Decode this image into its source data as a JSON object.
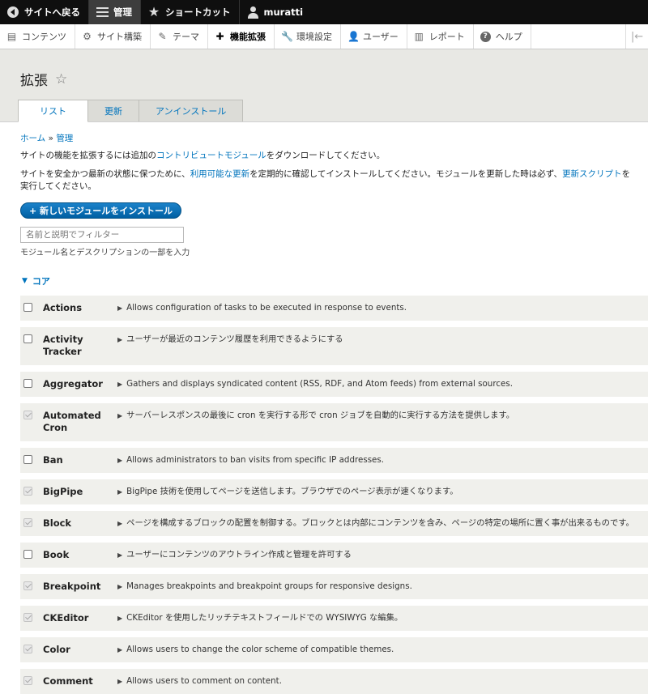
{
  "toolbar": {
    "back": "サイトへ戻る",
    "manage": "管理",
    "shortcuts": "ショートカット",
    "user": "muratti"
  },
  "tray": [
    {
      "label": "コンテンツ",
      "icon": "document-icon",
      "glyph": "▤"
    },
    {
      "label": "サイト構築",
      "icon": "structure-icon",
      "glyph": "⚙"
    },
    {
      "label": "テーマ",
      "icon": "paintbrush-icon",
      "glyph": "✎"
    },
    {
      "label": "機能拡張",
      "icon": "puzzle-icon",
      "glyph": "✚"
    },
    {
      "label": "環境設定",
      "icon": "wrench-icon",
      "glyph": "🔧"
    },
    {
      "label": "ユーザー",
      "icon": "people-icon",
      "glyph": "👤"
    },
    {
      "label": "レポート",
      "icon": "bar-chart-icon",
      "glyph": "▥"
    },
    {
      "label": "ヘルプ",
      "icon": "help-icon",
      "glyph": "?"
    }
  ],
  "page": {
    "title": "拡張",
    "tabs": [
      "リスト",
      "更新",
      "アンインストール"
    ]
  },
  "breadcrumb": {
    "home": "ホーム",
    "sep": "»",
    "admin": "管理"
  },
  "desc1": {
    "pre": "サイトの機能を拡張するには追加の",
    "link": "コントリビュートモジュール",
    "post": "をダウンロードしてください。"
  },
  "desc2": {
    "pre": "サイトを安全かつ最新の状態に保つために、",
    "link1": "利用可能な更新",
    "mid": "を定期的に確認してインストールしてください。モジュールを更新した時は必ず、",
    "link2": "更新スクリプト",
    "post": "を実行してください。"
  },
  "install_button": "+ 新しいモジュールをインストール",
  "filter": {
    "placeholder": "名前と説明でフィルター",
    "help": "モジュール名とデスクリプションの一部を入力"
  },
  "section": "コア",
  "modules": [
    {
      "name": "Actions",
      "desc": "Allows configuration of tasks to be executed in response to events."
    },
    {
      "name": "Activity Tracker",
      "desc": "ユーザーが最近のコンテンツ履歴を利用できるようにする"
    },
    {
      "name": "Aggregator",
      "desc": "Gathers and displays syndicated content (RSS, RDF, and Atom feeds) from external sources."
    },
    {
      "name": "Automated Cron",
      "desc": "サーバーレスポンスの最後に cron を実行する形で cron ジョブを自動的に実行する方法を提供します。"
    },
    {
      "name": "Ban",
      "desc": "Allows administrators to ban visits from specific IP addresses."
    },
    {
      "name": "BigPipe",
      "desc": "BigPipe 技術を使用してページを送信します。ブラウザでのページ表示が速くなります。"
    },
    {
      "name": "Block",
      "desc": "ページを構成するブロックの配置を制御する。ブロックとは内部にコンテンツを含み、ページの特定の場所に置く事が出来るものです。"
    },
    {
      "name": "Book",
      "desc": "ユーザーにコンテンツのアウトライン作成と管理を許可する"
    },
    {
      "name": "Breakpoint",
      "desc": "Manages breakpoints and breakpoint groups for responsive designs."
    },
    {
      "name": "CKEditor",
      "desc": "CKEditor を使用したリッチテキストフィールドでの WYSIWYG な編集。"
    },
    {
      "name": "Color",
      "desc": "Allows users to change the color scheme of compatible themes."
    },
    {
      "name": "Comment",
      "desc": "Allows users to comment on content."
    }
  ]
}
